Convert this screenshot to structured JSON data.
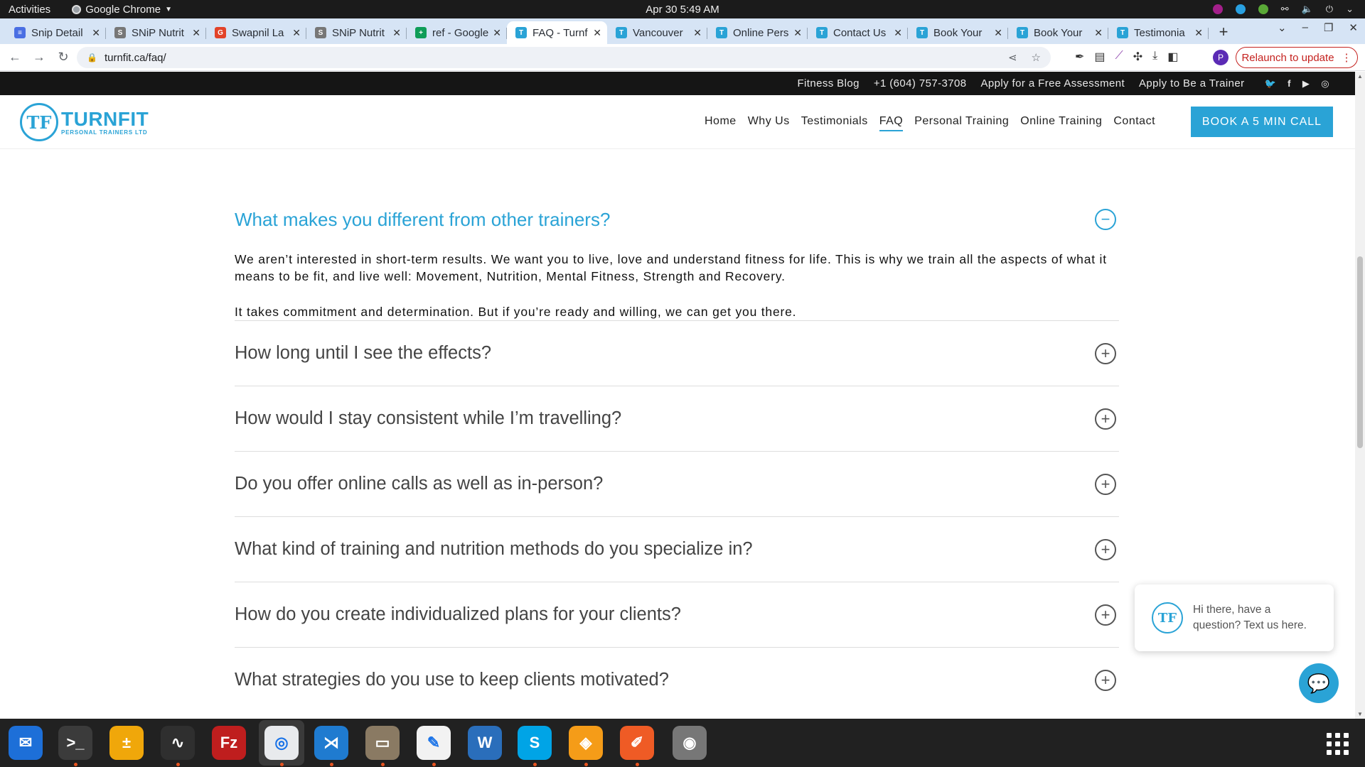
{
  "system": {
    "activities": "Activities",
    "app_name": "Google Chrome",
    "clock": "Apr 30  5:49 AM"
  },
  "tabs": [
    {
      "title": "Snip Detail",
      "fav_color": "#4a6fe3",
      "fav": "≡"
    },
    {
      "title": "SNiP Nutrit",
      "fav_color": "#777",
      "fav": "S"
    },
    {
      "title": "Swapnil La",
      "fav_color": "#e24329",
      "fav": "G"
    },
    {
      "title": "SNiP Nutrit",
      "fav_color": "#777",
      "fav": "S"
    },
    {
      "title": "ref - Google",
      "fav_color": "#0f9d58",
      "fav": "+"
    },
    {
      "title": "FAQ - Turnf",
      "fav_color": "#2aa3d6",
      "fav": "T",
      "active": true
    },
    {
      "title": "Vancouver",
      "fav_color": "#2aa3d6",
      "fav": "T"
    },
    {
      "title": "Online Pers",
      "fav_color": "#2aa3d6",
      "fav": "T"
    },
    {
      "title": "Contact Us",
      "fav_color": "#2aa3d6",
      "fav": "T"
    },
    {
      "title": "Book Your",
      "fav_color": "#2aa3d6",
      "fav": "T"
    },
    {
      "title": "Book Your",
      "fav_color": "#2aa3d6",
      "fav": "T"
    },
    {
      "title": "Testimonia",
      "fav_color": "#2aa3d6",
      "fav": "T"
    }
  ],
  "browser": {
    "url": "turnfit.ca/faq/",
    "relaunch_label": "Relaunch to update",
    "profile_initial": "P"
  },
  "site": {
    "util_links": [
      "Fitness Blog",
      "+1 (604) 757-3708",
      "Apply for a Free Assessment",
      "Apply to Be a Trainer"
    ],
    "logo_mark": "TF",
    "logo_name": "TURNFIT",
    "logo_sub": "PERSONAL TRAINERS LTD",
    "nav": [
      "Home",
      "Why Us",
      "Testimonials",
      "FAQ",
      "Personal Training",
      "Online Training",
      "Contact"
    ],
    "nav_current": "FAQ",
    "book_button": "BOOK A 5 MIN CALL",
    "accent": "#2aa3d6"
  },
  "faq": {
    "open_question": "What makes you different from other trainers?",
    "answer_p1": "We aren’t interested in short-term results. We want you to live, love and understand fitness for life. This is why we train all the aspects of what it means to be fit, and live well: Movement, Nutrition, Mental Fitness, Strength and Recovery.",
    "answer_p2": "It takes commitment and determination. But if you’re ready and willing, we can get you there.",
    "questions": [
      "How long until I see the effects?",
      "How would I stay consistent while I’m travelling?",
      "Do you offer online calls as well as in-person?",
      "What kind of training and nutrition methods do you specialize in?",
      "How do you create individualized plans for your clients?",
      "What strategies do you use to keep clients motivated?"
    ]
  },
  "chat": {
    "avatar": "TF",
    "message": "Hi there, have a question? Text us here."
  },
  "dock": [
    {
      "name": "thunderbird",
      "color": "#1d6fd8",
      "glyph": "✉",
      "running": false
    },
    {
      "name": "terminal",
      "color": "#3b3b3b",
      "glyph": ">_",
      "running": true
    },
    {
      "name": "calculator",
      "color": "#f0a70a",
      "glyph": "±",
      "running": false
    },
    {
      "name": "system-monitor",
      "color": "#2f2f2f",
      "glyph": "∿",
      "running": true
    },
    {
      "name": "filezilla",
      "color": "#bf1e1e",
      "glyph": "Fz",
      "running": false
    },
    {
      "name": "chrome",
      "color": "#e8eaed",
      "glyph": "◎",
      "running": true
    },
    {
      "name": "vscode",
      "color": "#1f7bd0",
      "glyph": "⋊",
      "running": true
    },
    {
      "name": "files",
      "color": "#8a7a63",
      "glyph": "▭",
      "running": true
    },
    {
      "name": "text-editor",
      "color": "#f2f2f2",
      "glyph": "✎",
      "running": true
    },
    {
      "name": "libreoffice-writer",
      "color": "#2a6ebb",
      "glyph": "W",
      "running": false
    },
    {
      "name": "skype",
      "color": "#00a4e6",
      "glyph": "S",
      "running": true
    },
    {
      "name": "app-fire",
      "color": "#f59c18",
      "glyph": "◈",
      "running": true
    },
    {
      "name": "postman",
      "color": "#ef5b25",
      "glyph": "✐",
      "running": true
    },
    {
      "name": "disk",
      "color": "#777777",
      "glyph": "◉",
      "running": false
    }
  ]
}
